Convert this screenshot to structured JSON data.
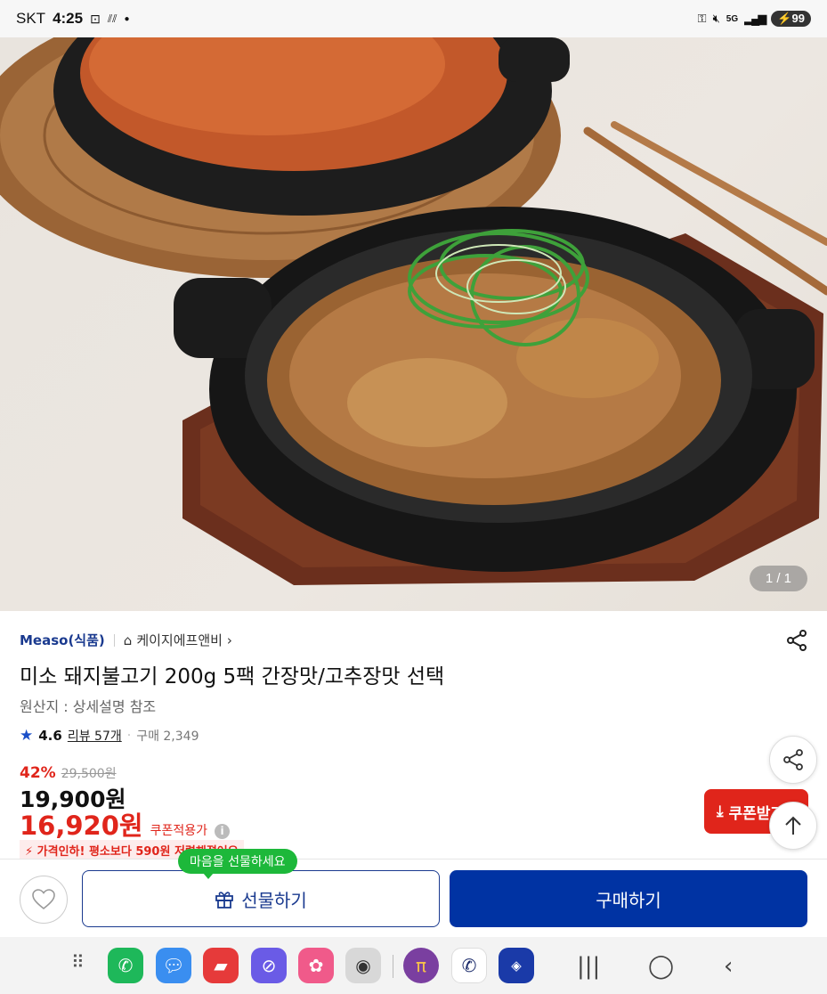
{
  "status_bar": {
    "carrier": "SKT",
    "time": "4:25",
    "network": "5G",
    "battery": "99"
  },
  "hero": {
    "image_counter": "1 / 1"
  },
  "product": {
    "brand": "Measo(식품)",
    "store": "케이지에프앤비",
    "title": "미소 돼지불고기 200g 5팩 간장맛/고추장맛 선택",
    "origin": "원산지 : 상세설명 참조",
    "rating": "4.6",
    "review_label": "리뷰 57개",
    "purchase_label": "구매 2,349",
    "discount_pct": "42%",
    "original_price": "29,500원",
    "price": "19,900원",
    "coupon_price": "16,920원",
    "coupon_label": "쿠폰적용가",
    "promo_text": "가격인하! 평소보다 590원 저렴해졌어요"
  },
  "floating": {
    "coupon_button": "쿠폰받기"
  },
  "bottom_bar": {
    "gift_tooltip": "마음을 선물하세요",
    "gift_button": "선물하기",
    "buy_button": "구매하기"
  },
  "colors": {
    "brand_blue": "#0033a3",
    "sale_red": "#e0251b",
    "tooltip_green": "#1db83a"
  }
}
